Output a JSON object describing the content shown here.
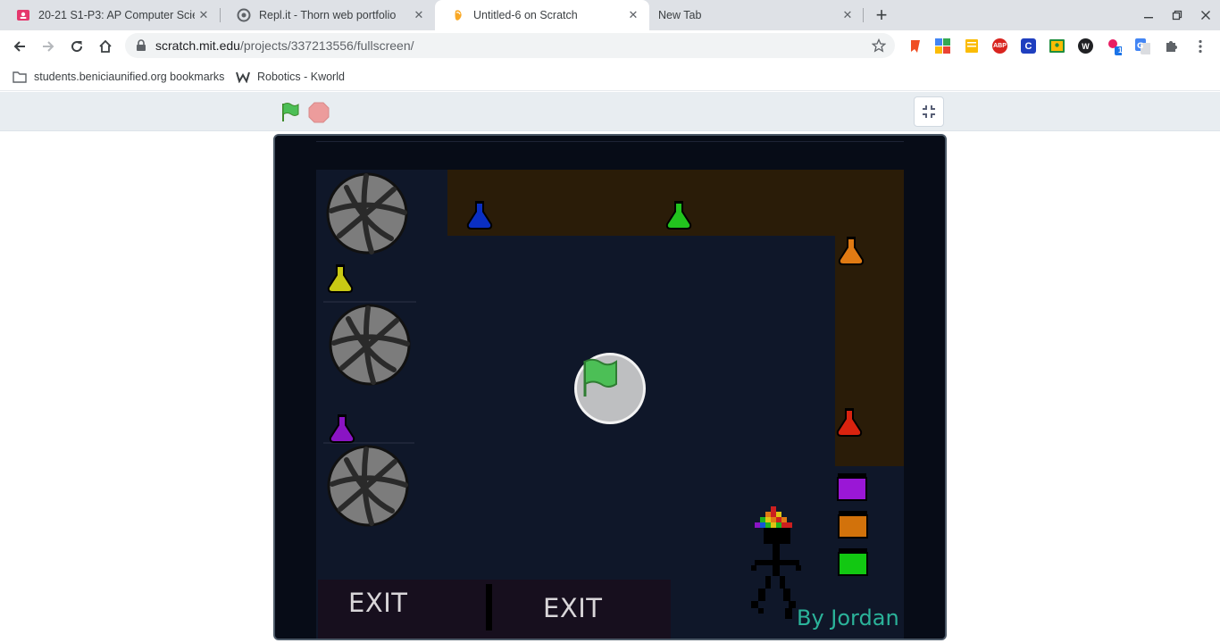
{
  "tabs": [
    {
      "title": "20-21 S1-P3: AP Computer Scien",
      "icon": "classroom-icon",
      "active": false
    },
    {
      "title": "Repl.it - Thorn web portfolio",
      "icon": "replit-icon",
      "active": false
    },
    {
      "title": "Untitled-6 on Scratch",
      "icon": "scratch-icon",
      "active": true
    },
    {
      "title": "New Tab",
      "icon": "",
      "active": false
    }
  ],
  "address_bar": {
    "host": "scratch.mit.edu",
    "path": "/projects/337213556/fullscreen/"
  },
  "bookmarks": [
    {
      "label": "students.beniciaunified.org bookmarks",
      "icon": "folder-icon"
    },
    {
      "label": "Robotics - Kworld",
      "icon": "kworld-icon"
    }
  ],
  "extensions": [
    "bookmark-ext-icon",
    "translate-ext-icon",
    "keep-ext-icon",
    "adblock-plus-icon",
    "c-ext-icon",
    "classroom-ext-icon",
    "w-ext-icon",
    "badge-ext-icon",
    "google-translate-icon",
    "puzzle-icon"
  ],
  "extension_badge": "1",
  "adblock_label": "ABP",
  "c_ext_label": "C",
  "w_ext_label": "W",
  "stage": {
    "exit_left": "EXIT",
    "exit_right": "EXIT",
    "byline": "By Jordan"
  },
  "colors": {
    "stage_bg": "#0f1729",
    "shelf_brown": "#2a1c08",
    "accent_teal": "#2bb39a",
    "scratch_bar": "#e8edf1"
  }
}
